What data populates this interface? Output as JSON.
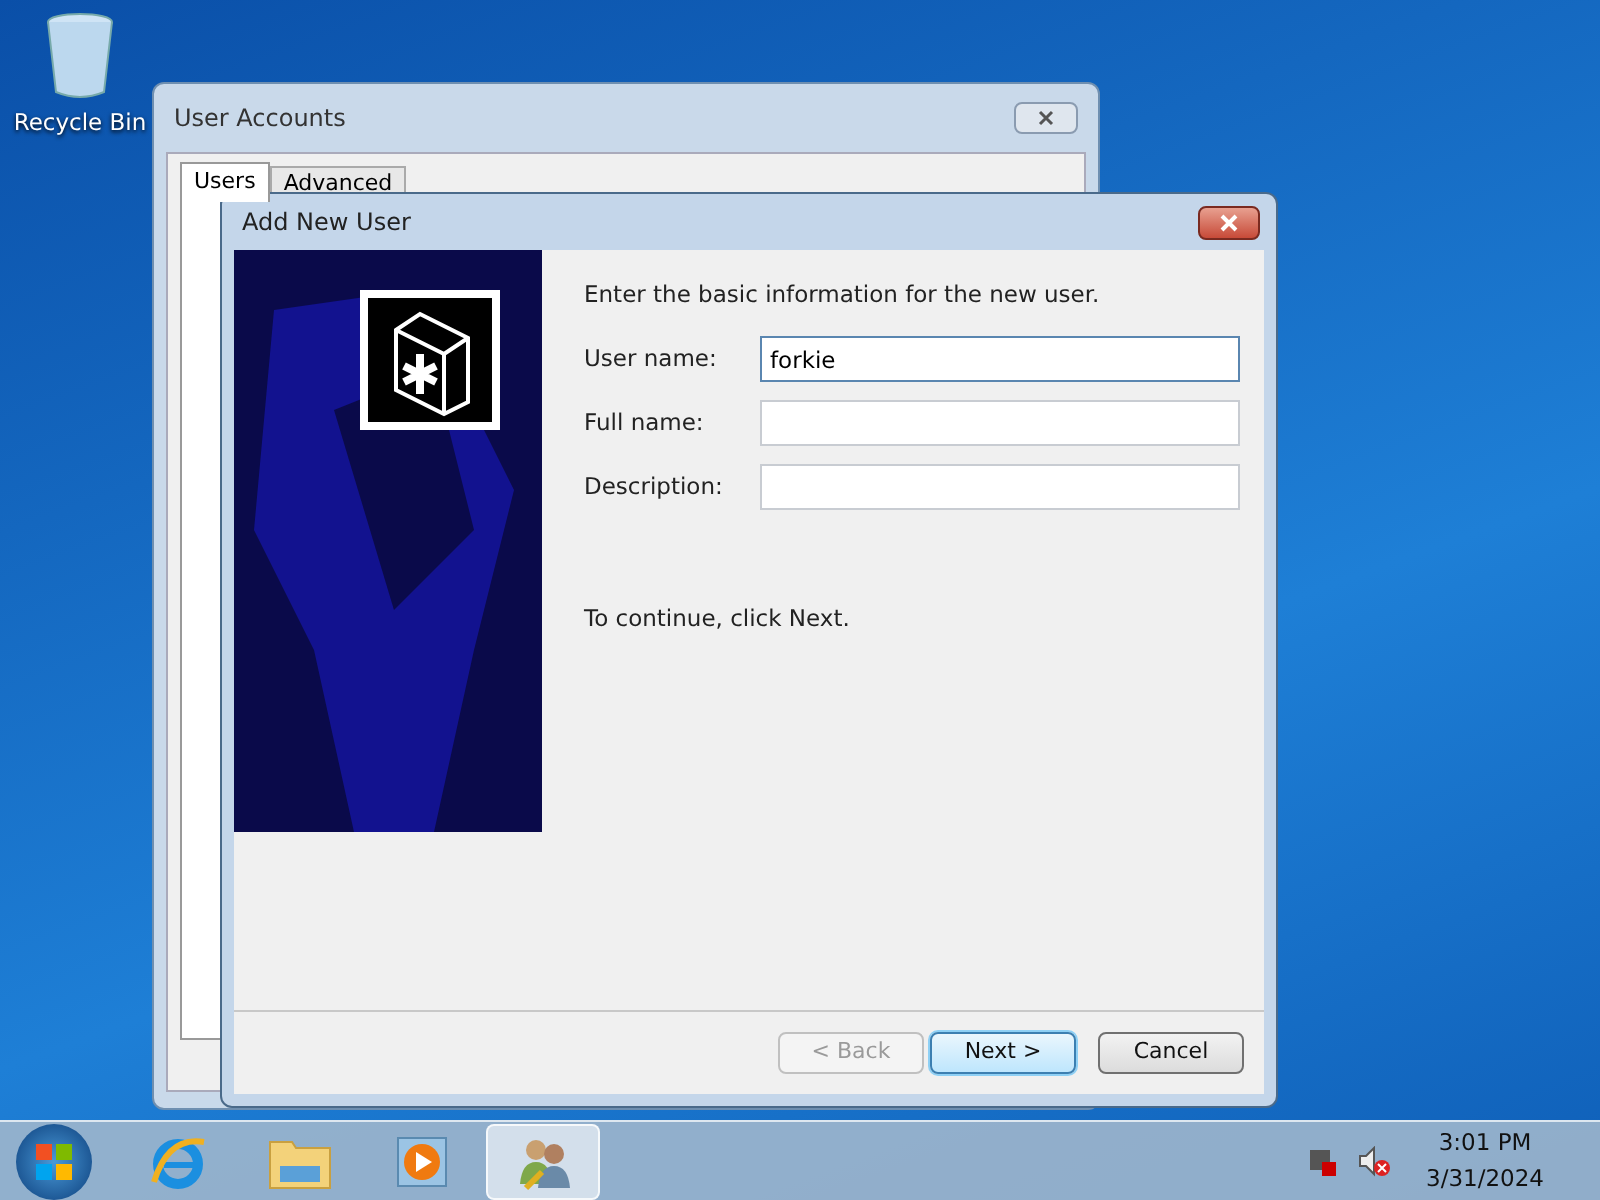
{
  "desktop_icons": [
    {
      "label": "Recycle Bin"
    }
  ],
  "background_window": {
    "title": "User Accounts",
    "tabs": [
      {
        "label": "Users",
        "selected": true
      },
      {
        "label": "Advanced",
        "selected": false
      }
    ]
  },
  "dialog": {
    "title": "Add New User",
    "intro": "Enter the basic information for the new user.",
    "fields": [
      {
        "label": "User name:",
        "value": "forkie",
        "focused": true
      },
      {
        "label": "Full name:",
        "focused": false
      },
      {
        "label": "Description:",
        "focused": false
      }
    ],
    "hint": "To continue, click Next.",
    "buttons": [
      {
        "label": "< Back",
        "disabled": true,
        "default": false
      },
      {
        "label": "Next >",
        "disabled": false,
        "default": true
      },
      {
        "label": "Cancel",
        "disabled": false,
        "default": false
      }
    ]
  },
  "taskbar": {
    "items": [
      {
        "kind": "ie",
        "active": false
      },
      {
        "kind": "folder",
        "active": false
      },
      {
        "kind": "media",
        "active": false
      },
      {
        "kind": "users",
        "active": true
      }
    ],
    "time": "3:01 PM",
    "date": "3/31/2024"
  }
}
